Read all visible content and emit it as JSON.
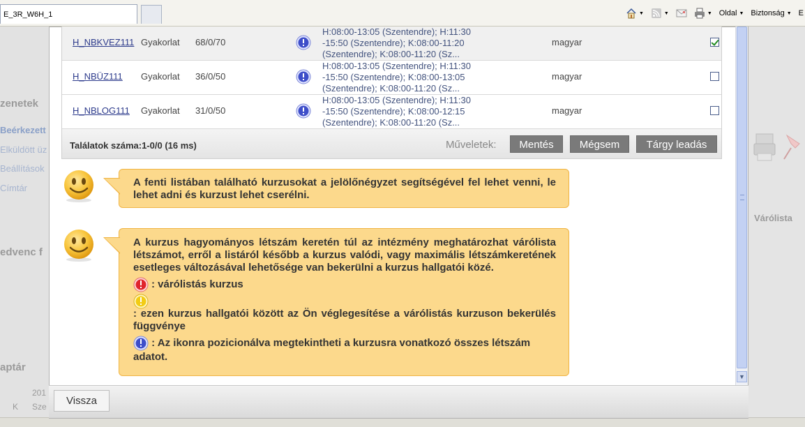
{
  "browser": {
    "tab_title": "E_3R_W6H_1",
    "toolbar": {
      "page_label": "Oldal",
      "security_label": "Biztonság",
      "extra_label": "E"
    }
  },
  "background": {
    "left_texts": [
      "zenetek",
      "Beérkezett",
      "Elküldött üz",
      "Beállítások",
      "Címtár",
      "edvenc f",
      "aptár",
      "201",
      "K",
      "Sze"
    ],
    "right_texts": [
      "Várólista"
    ]
  },
  "table": {
    "rows": [
      {
        "code": "H_NBKVEZ111",
        "type": "Gyakorlat",
        "count": "68/0/70",
        "times": "H:08:00-13:05 (Szentendre); H:11:30\n-15:50 (Szentendre); K:08:00-11:20\n(Szentendre); K:08:00-11:20 (Sz...",
        "language": "magyar",
        "checked": true
      },
      {
        "code": "H_NBÜZ111",
        "type": "Gyakorlat",
        "count": "36/0/50",
        "times": "H:08:00-13:05 (Szentendre); H:11:30\n-15:50 (Szentendre); K:08:00-13:05\n(Szentendre); K:08:00-11:20 (Sz...",
        "language": "magyar",
        "checked": false
      },
      {
        "code": "H_NBLOG111",
        "type": "Gyakorlat",
        "count": "31/0/50",
        "times": "H:08:00-13:05 (Szentendre); H:11:30\n-15:50 (Szentendre); K:08:00-12:15\n(Szentendre); K:08:00-11:20 (Sz...",
        "language": "magyar",
        "checked": false
      }
    ],
    "footer": {
      "results": "Találatok száma:1-0/0 (16 ms)",
      "actions_label": "Műveletek:",
      "save": "Mentés",
      "cancel": "Mégsem",
      "drop": "Tárgy leadás"
    }
  },
  "help": {
    "box1": "A fenti listában található kurzusokat a jelölőnégyzet segítségével fel lehet venni, le lehet adni és kurzust lehet cserélni.",
    "box2_text": "A kurzus hagyományos létszám keretén túl az intézmény meghatározhat várólista létszámot, erről a listáról később a kurzus valódi, vagy maximális létszámkeretének esetleges változásával lehetősége van bekerülni a kurzus hallgatói közé.",
    "legend_red": ": várólistás kurzus",
    "legend_yellow": ": ezen kurzus hallgatói között az Ön véglegesítése a várólistás kurzuson bekerülés függvénye",
    "legend_blue": ": Az ikonra pozicionálva megtekintheti a kurzusra vonatkozó összes létszám adatot."
  },
  "bottom": {
    "back": "Vissza"
  },
  "colors": {
    "bubble_bg": "#fcd98c",
    "bubble_border": "#f0b443",
    "button_gray": "#7a7a7a",
    "link_blue": "#2d3b8c"
  }
}
